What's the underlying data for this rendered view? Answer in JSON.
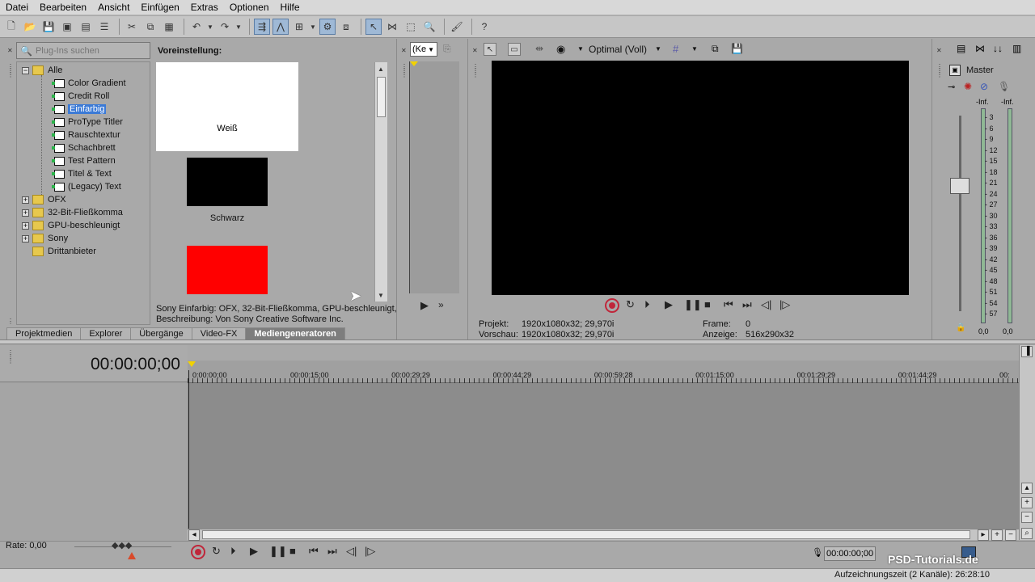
{
  "menu": [
    "Datei",
    "Bearbeiten",
    "Ansicht",
    "Einfügen",
    "Extras",
    "Optionen",
    "Hilfe"
  ],
  "toolbar": {
    "icons": [
      "new-icon",
      "open-icon",
      "save-icon",
      "save-as-icon",
      "render-icon",
      "properties-icon",
      "cut-icon",
      "copy-icon",
      "paste-icon",
      "undo-icon",
      "redo-icon",
      "auto-ripple-icon",
      "envelope-icon",
      "snap-icon",
      "lock-icon",
      "normal-edit-tool-icon",
      "envelope-tool-icon",
      "selection-tool-icon",
      "zoom-tool-icon",
      "paint-icon",
      "help-icon"
    ]
  },
  "plugins": {
    "search_placeholder": "Plug-Ins suchen",
    "root": "Alle",
    "children": [
      "Color Gradient",
      "Credit Roll",
      "Einfarbig",
      "ProType Titler",
      "Rauschtextur",
      "Schachbrett",
      "Test Pattern",
      "Titel & Text",
      "(Legacy) Text"
    ],
    "selected": "Einfarbig",
    "folders": [
      "OFX",
      "32-Bit-Fließkomma",
      "GPU-beschleunigt",
      "Sony",
      "Drittanbieter"
    ]
  },
  "presets": {
    "title": "Voreinstellung:",
    "items": [
      {
        "label": "Weiß",
        "color": "#ffffff"
      },
      {
        "label": "Schwarz",
        "color": "#000000"
      },
      {
        "label": "",
        "color": "#ff0000"
      }
    ],
    "description_line1": "Sony Einfarbig: OFX, 32-Bit-Fließkomma, GPU-beschleunigt,",
    "description_line2": "Beschreibung: Von Sony Creative Software Inc."
  },
  "tabs": [
    "Projektmedien",
    "Explorer",
    "Übergänge",
    "Video-FX",
    "Mediengeneratoren"
  ],
  "active_tab": "Mediengeneratoren",
  "trimmer": {
    "combo": "(Ke"
  },
  "preview": {
    "quality": "Optimal (Voll)",
    "projekt_label": "Projekt:",
    "projekt_value": "1920x1080x32; 29,970i",
    "vorschau_label": "Vorschau:",
    "vorschau_value": "1920x1080x32; 29,970i",
    "frame_label": "Frame:",
    "frame_value": "0",
    "anzeige_label": "Anzeige:",
    "anzeige_value": "516x290x32"
  },
  "master": {
    "label": "Master",
    "inf_left": "-Inf.",
    "inf_right": "-Inf.",
    "scale": [
      "3",
      "6",
      "9",
      "12",
      "15",
      "18",
      "21",
      "24",
      "27",
      "30",
      "33",
      "36",
      "39",
      "42",
      "45",
      "48",
      "51",
      "54",
      "57"
    ],
    "level_left": "0,0",
    "level_right": "0,0"
  },
  "timeline": {
    "timecode": "00:00:00;00",
    "ruler": [
      "0:00:00;00",
      "00:00:15;00",
      "00:00:29;29",
      "00:00:44;29",
      "00:00:59;28",
      "00:01:15;00",
      "00:01:29;29",
      "00:01:44;29",
      "00:"
    ],
    "rate": "Rate: 0,00",
    "cursor_tc": "00:00:00;00"
  },
  "status": {
    "recording": "Aufzeichnungszeit (2 Kanäle): 26:28:10"
  },
  "watermark": "PSD-Tutorials.de",
  "colors": {
    "selection": "#3b7ad6",
    "record": "#c0263a"
  }
}
